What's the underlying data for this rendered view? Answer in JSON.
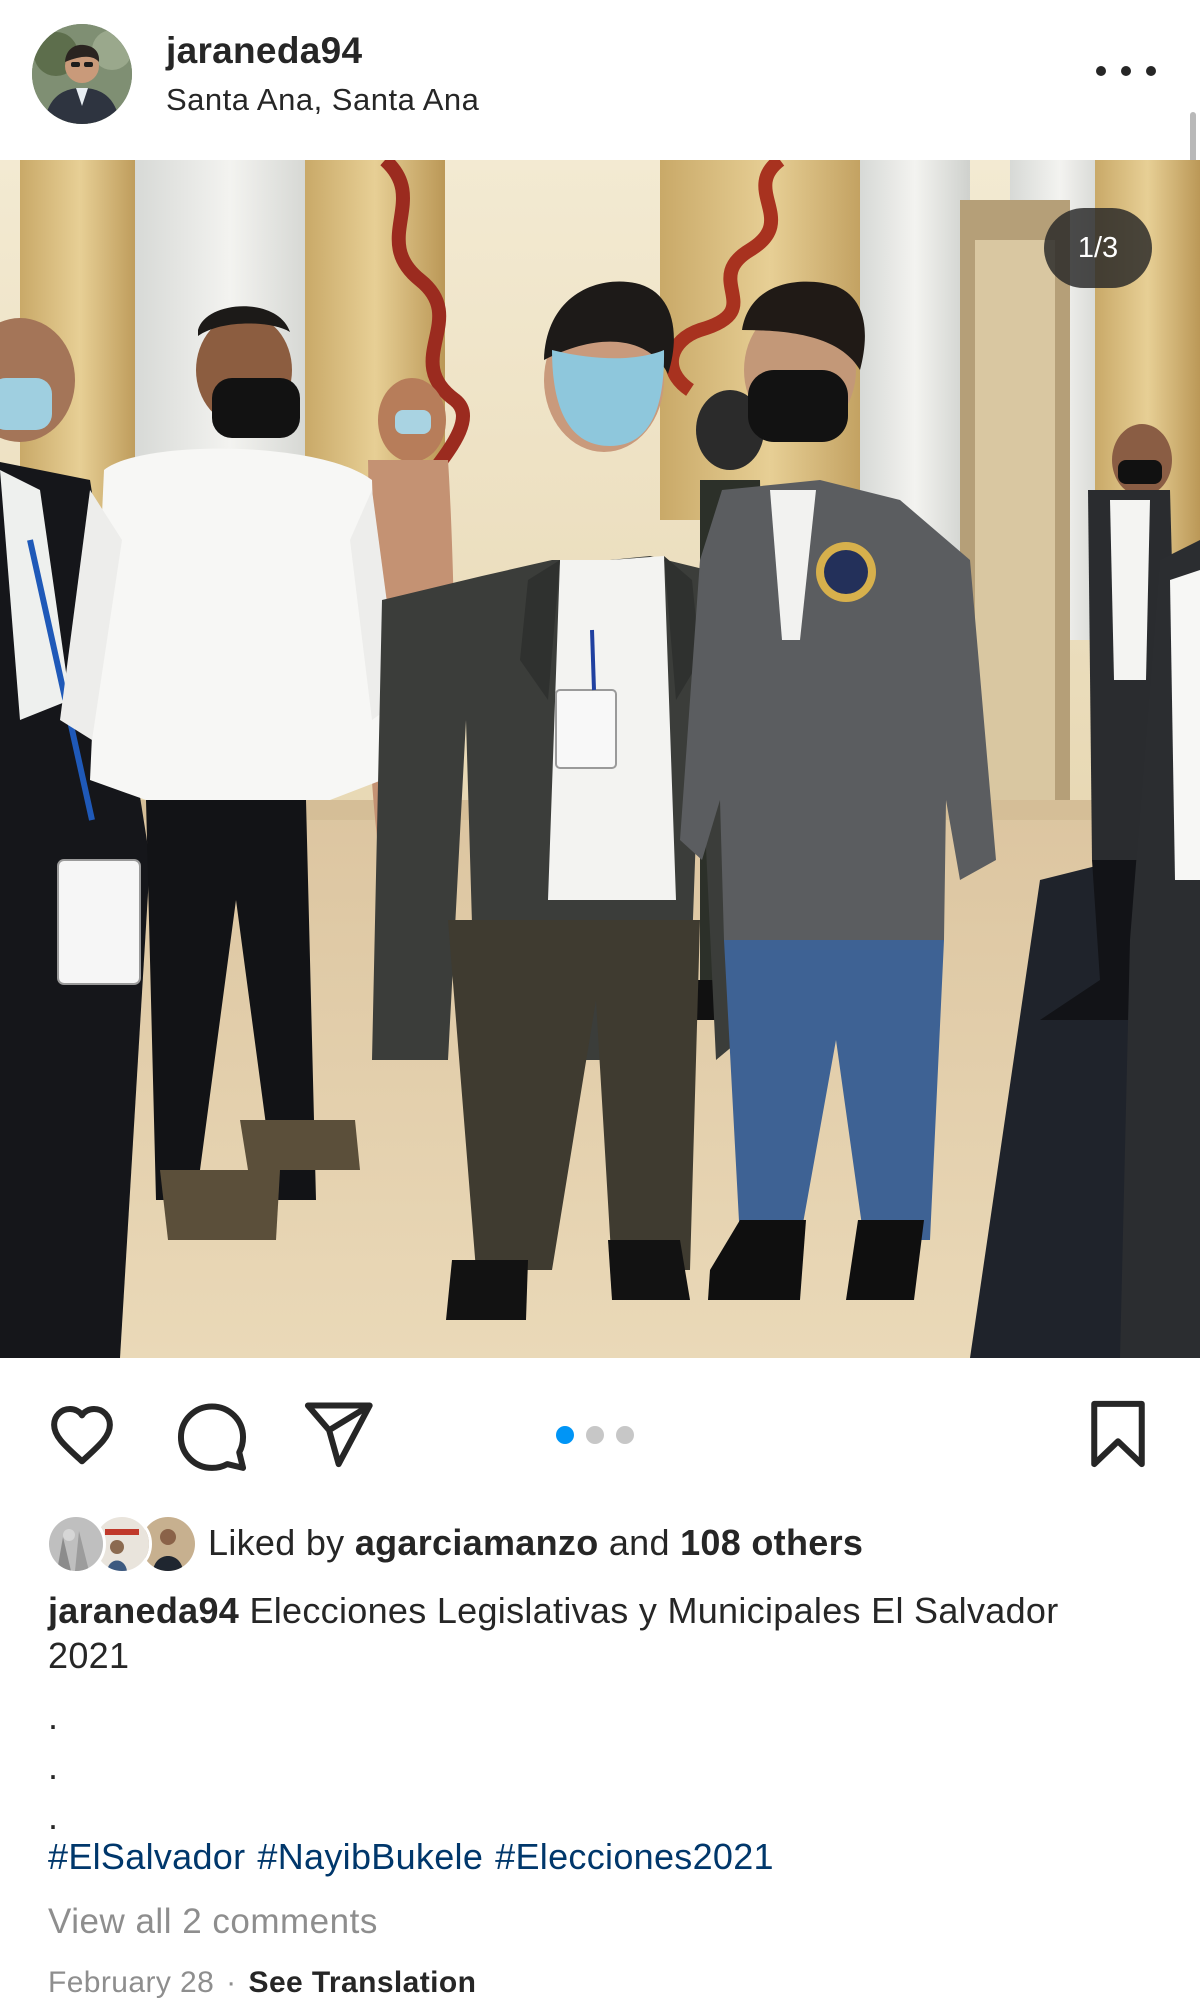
{
  "header": {
    "username": "jaraneda94",
    "location": "Santa Ana, Santa Ana",
    "more_icon": "more-horizontal-icon"
  },
  "photo": {
    "page_indicator": "1/3",
    "current_page": 1,
    "total_pages": 3
  },
  "actions": {
    "icons": [
      "heart-icon",
      "comment-icon",
      "send-icon",
      "bookmark-icon"
    ],
    "carousel_active_color": "#0095f6",
    "carousel_inactive_color": "#c7c7c7"
  },
  "likes": {
    "prefix": "Liked by",
    "first_liker": "agarciamanzo",
    "conjunction": "and",
    "others": "108 others"
  },
  "caption": {
    "username": "jaraneda94",
    "text": "Elecciones Legislativas y Municipales El Salvador 2021",
    "dot": ".",
    "hashtags": [
      "#ElSalvador",
      "#NayibBukele",
      "#Elecciones2021"
    ]
  },
  "comments": {
    "view_all": "View all 2 comments"
  },
  "meta": {
    "date": "February 28",
    "separator": "·",
    "see_translation": "See Translation"
  },
  "colors": {
    "text": "#262626",
    "muted": "#8e8e8e",
    "hashtag": "#00376b",
    "accent": "#0095f6"
  }
}
